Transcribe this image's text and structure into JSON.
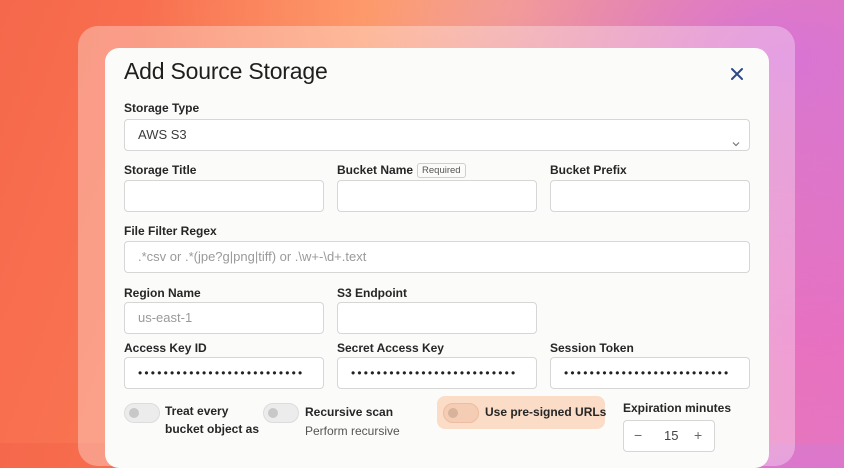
{
  "dialog": {
    "title": "Add Source Storage",
    "close_icon": "close-icon"
  },
  "storage_type": {
    "label": "Storage Type",
    "value": "AWS S3"
  },
  "storage_title": {
    "label": "Storage Title",
    "value": ""
  },
  "bucket_name": {
    "label": "Bucket Name",
    "badge": "Required",
    "value": ""
  },
  "bucket_prefix": {
    "label": "Bucket Prefix",
    "value": ""
  },
  "file_filter": {
    "label": "File Filter Regex",
    "placeholder": ".*csv or .*(jpe?g|png|tiff) or .\\w+-\\d+.text"
  },
  "region": {
    "label": "Region Name",
    "placeholder": "us-east-1"
  },
  "s3_endpoint": {
    "label": "S3 Endpoint",
    "value": ""
  },
  "access_key": {
    "label": "Access Key ID",
    "value": "••••••••••••••••••••••••••"
  },
  "secret_key": {
    "label": "Secret Access Key",
    "value": "••••••••••••••••••••••••••"
  },
  "session_token": {
    "label": "Session Token",
    "value": "••••••••••••••••••••••••••"
  },
  "toggles": {
    "treat_every": {
      "line1": "Treat every",
      "line2": "bucket object as",
      "enabled": false
    },
    "recursive": {
      "label": "Recursive scan",
      "sub": "Perform recursive",
      "enabled": false
    },
    "presigned": {
      "label": "Use pre-signed URLs",
      "enabled": false,
      "highlight": "#fbdcc7"
    }
  },
  "expiration": {
    "label": "Expiration minutes",
    "value": "15",
    "minus": "−",
    "plus": "+"
  }
}
